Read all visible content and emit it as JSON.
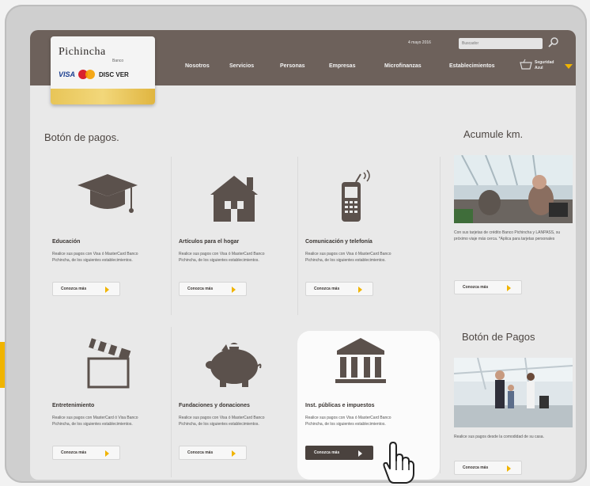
{
  "brand": {
    "name": "Pichincha",
    "sub": "Banco",
    "cards": {
      "visa": "VISA",
      "discover": "DISC VER"
    }
  },
  "header": {
    "date": "4 mayo 2016",
    "search_placeholder": "Buscador",
    "login": [
      "Seguridad",
      "Azul"
    ]
  },
  "nav": [
    "Nosotros",
    "Servicios",
    "Personas",
    "Empresas",
    "Microfinanzas",
    "Establecimientos"
  ],
  "payments_title": "Botón de pagos.",
  "tiles": [
    {
      "icon": "graduation-cap-icon",
      "title": "Educación",
      "desc": "Realice sus pagos con Visa ó MasterCard Banco Pichincha, de los siguientes establecimientos.",
      "button": "Conozca más"
    },
    {
      "icon": "house-icon",
      "title": "Artículos para el hogar",
      "desc": "Realice sus pagos con Visa ó MasterCard Banco Pichincha, de los siguientes establecimientos.",
      "button": "Conozca más"
    },
    {
      "icon": "mobile-phone-icon",
      "title": "Comunicación y telefonía",
      "desc": "Realice sus pagos con Visa ó MasterCard Banco Pichincha, de los siguientes establecimientos.",
      "button": "Conozca más"
    },
    {
      "icon": "clapperboard-icon",
      "title": "Entretenimiento",
      "desc": "Realice sus pagos con MasterCard ó Visa Banco Pichincha, de los siguientes establecimientos.",
      "button": "Conozca más"
    },
    {
      "icon": "piggy-bank-icon",
      "title": "Fundaciones y donaciones",
      "desc": "Realice sus pagos con Visa ó MasterCard Banco Pichincha, de los siguientes establecimientos.",
      "button": "Conozca más"
    },
    {
      "icon": "bank-building-icon",
      "title": "Inst. públicas e impuestos",
      "desc": "Realice sus pagos con Visa ó MasterCard Banco Pichincha, de los siguientes establecimientos.",
      "button": "Conozca más"
    }
  ],
  "sidebar": {
    "km_title": "Acumule km.",
    "km_text": "Con sus tarjetas de crédito Banco Pichincha y LANPASS, su próximo viaje más cerca. *Aplica para tarjetas personales",
    "km_button": "Conozca más",
    "pay_title": "Botón de Pagos",
    "pay_text": "Realice sus pagos desde la comodidad de su casa.",
    "pay_button": "Conozca más"
  },
  "colors": {
    "brand_brown": "#6d615b",
    "accent_yellow": "#f0b400",
    "icon_brown": "#5b514c"
  }
}
